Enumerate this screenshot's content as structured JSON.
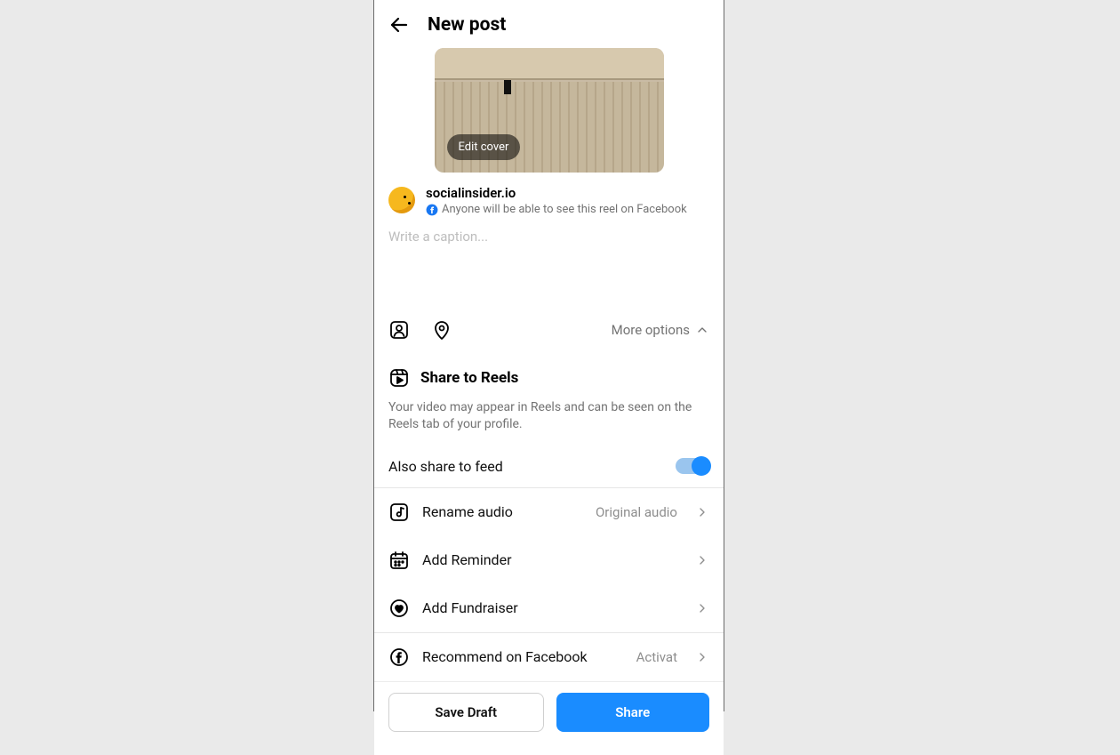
{
  "header": {
    "title": "New post"
  },
  "cover": {
    "edit_label": "Edit cover"
  },
  "account": {
    "username": "socialinsider.io",
    "visibility_text": "Anyone will be able to see this reel on Facebook"
  },
  "caption": {
    "placeholder": "Write a caption..."
  },
  "options": {
    "more_label": "More options"
  },
  "share_reels": {
    "title": "Share to Reels",
    "description": "Your video may appear in Reels and can be seen on the Reels tab of your profile.",
    "toggle_label": "Also share to feed",
    "toggle_on": true
  },
  "list": {
    "rename_audio": {
      "label": "Rename audio",
      "value": "Original audio"
    },
    "add_reminder": {
      "label": "Add Reminder"
    },
    "add_fundraiser": {
      "label": "Add Fundraiser"
    },
    "recommend_fb": {
      "label": "Recommend on Facebook",
      "value": "Activat"
    }
  },
  "buttons": {
    "save_draft": "Save Draft",
    "share": "Share"
  },
  "colors": {
    "primary": "#1a8cff",
    "text_secondary": "#737373"
  }
}
